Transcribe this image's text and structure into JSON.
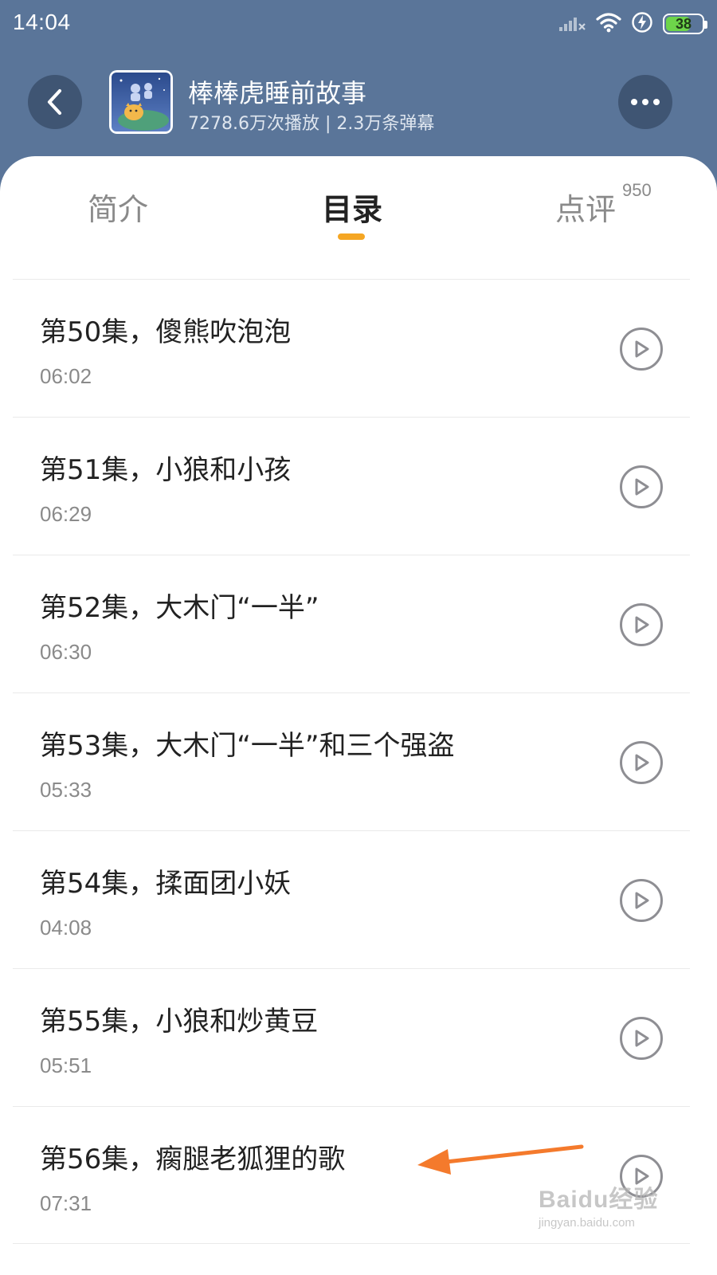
{
  "status_bar": {
    "time": "14:04",
    "battery": "38",
    "icons": [
      "signal-icon",
      "wifi-icon",
      "charging-icon",
      "battery-icon"
    ]
  },
  "header": {
    "title": "棒棒虎睡前故事",
    "stats": "7278.6万次播放 | 2.3万条弹幕",
    "back_icon": "back-arrow-icon",
    "more_icon": "more-dots-icon"
  },
  "tabs": [
    {
      "label": "简介",
      "active": false
    },
    {
      "label": "目录",
      "active": true
    },
    {
      "label": "点评",
      "active": false,
      "badge": "950"
    }
  ],
  "colors": {
    "header_bg": "#5a7599",
    "accent": "#f5a623",
    "button_bg": "#3f5573",
    "annotation_arrow": "#f47a2c"
  },
  "episodes": [
    {
      "title": "第50集，傻熊吹泡泡",
      "duration": "06:02"
    },
    {
      "title": "第51集，小狼和小孩",
      "duration": "06:29"
    },
    {
      "title": "第52集，大木门“一半”",
      "duration": "06:30"
    },
    {
      "title": "第53集，大木门“一半”和三个强盗",
      "duration": "05:33"
    },
    {
      "title": "第54集，揉面团小妖",
      "duration": "04:08"
    },
    {
      "title": "第55集，小狼和炒黄豆",
      "duration": "05:51"
    },
    {
      "title": "第56集，瘸腿老狐狸的歌",
      "duration": "07:31"
    }
  ],
  "watermark": {
    "main": "Baidu经验",
    "sub": "jingyan.baidu.com"
  }
}
